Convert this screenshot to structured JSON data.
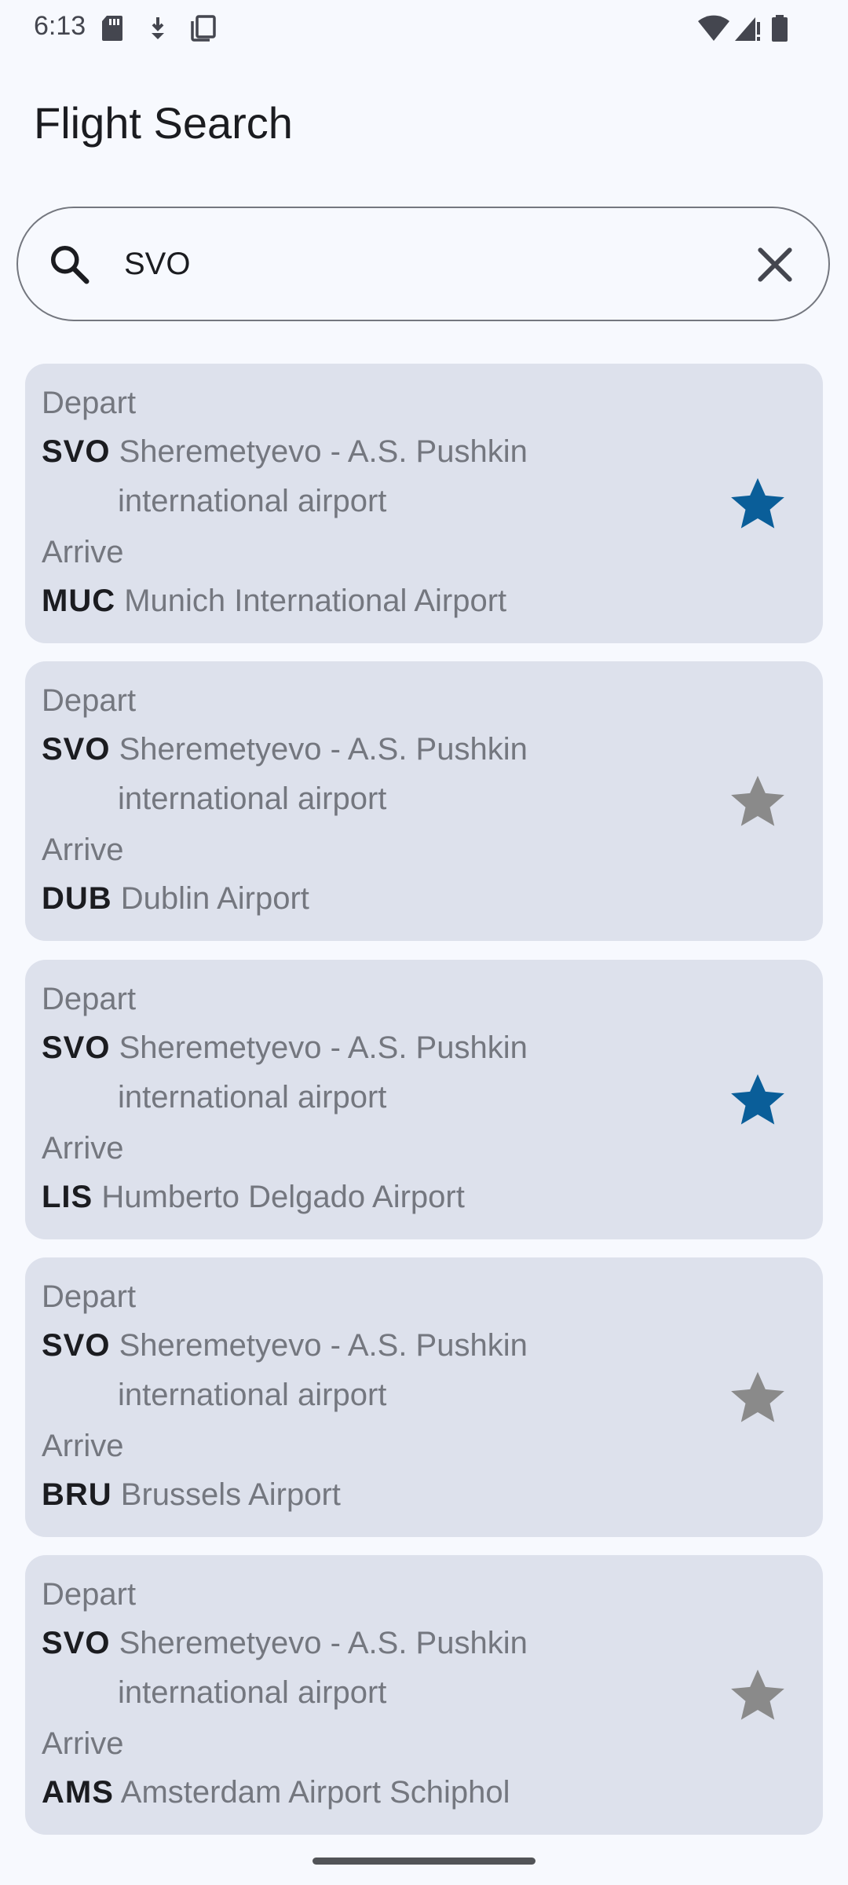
{
  "status_bar": {
    "time": "6:13"
  },
  "app": {
    "title": "Flight Search"
  },
  "search": {
    "value": "SVO"
  },
  "labels": {
    "depart": "Depart",
    "arrive": "Arrive"
  },
  "colors": {
    "favorite": "#0a5e99",
    "not_favorite": "#8a8a8a",
    "card": "#dde1ec"
  },
  "flights": [
    {
      "depart_code": "SVO",
      "depart_name_line1": "Sheremetyevo - A.S. Pushkin",
      "depart_name_line2": "international airport",
      "arrive_code": "MUC",
      "arrive_name": "Munich International Airport",
      "favorite": true
    },
    {
      "depart_code": "SVO",
      "depart_name_line1": "Sheremetyevo - A.S. Pushkin",
      "depart_name_line2": "international airport",
      "arrive_code": "DUB",
      "arrive_name": "Dublin Airport",
      "favorite": false
    },
    {
      "depart_code": "SVO",
      "depart_name_line1": "Sheremetyevo - A.S. Pushkin",
      "depart_name_line2": "international airport",
      "arrive_code": "LIS",
      "arrive_name": "Humberto Delgado Airport",
      "favorite": true
    },
    {
      "depart_code": "SVO",
      "depart_name_line1": "Sheremetyevo - A.S. Pushkin",
      "depart_name_line2": "international airport",
      "arrive_code": "BRU",
      "arrive_name": "Brussels Airport",
      "favorite": false
    },
    {
      "depart_code": "SVO",
      "depart_name_line1": "Sheremetyevo - A.S. Pushkin",
      "depart_name_line2": "international airport",
      "arrive_code": "AMS",
      "arrive_name": "Amsterdam Airport Schiphol",
      "favorite": false
    }
  ]
}
